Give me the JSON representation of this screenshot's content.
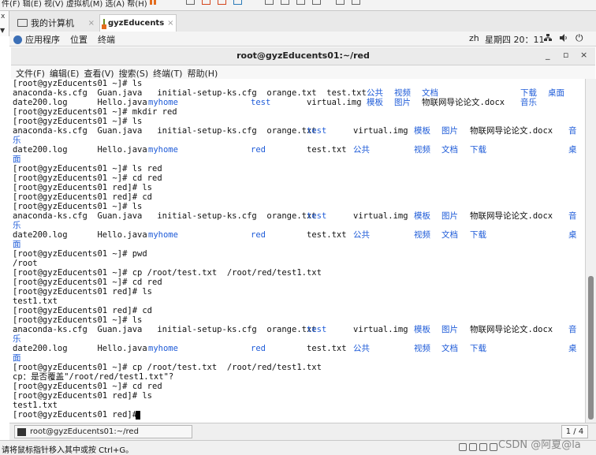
{
  "vm_toolbar": {
    "menu_text": "件(F)  辑(E)  视(V)  虚拟机(M)  选(A)  帮(H)"
  },
  "vm_left": {
    "close": "x",
    "dropdown": "▼"
  },
  "tabs": [
    {
      "label": "我的计算机",
      "close": "×",
      "icon": "computer-icon"
    },
    {
      "label": "gyzEducents",
      "close": "×",
      "icon": "vm-icon"
    }
  ],
  "topbar": {
    "applications": "应用程序",
    "places": "位置",
    "terminal": "终端",
    "lang": "zh",
    "clock": "星期四 20：11",
    "power": "⏻"
  },
  "window": {
    "title": "root@gyzEducents01:~/red",
    "minimize": "_",
    "maximize": "▫",
    "close": "×"
  },
  "menubar": [
    "文件(F)",
    "编辑(E)",
    "查看(V)",
    "搜索(S)",
    "终端(T)",
    "帮助(H)"
  ],
  "terminal": {
    "lines": [
      "[root@gyzEducents01 ~]# ls",
      "anaconda-ks.cfg  Guan.java   initial-setup-ks.cfg  orange.txt  test.txt",
      "date200.log      Hello.java",
      "[root@gyzEducents01 ~]# mkdir red",
      "[root@gyzEducents01 ~]# ls",
      "anaconda-ks.cfg  Guan.java   initial-setup-ks.cfg  orange.txt",
      "乐",
      "date200.log      Hello.java",
      "面",
      "[root@gyzEducents01 ~]# ls red",
      "[root@gyzEducents01 ~]# cd red",
      "[root@gyzEducents01 red]# ls",
      "[root@gyzEducents01 red]# cd",
      "[root@gyzEducents01 ~]# ls",
      "anaconda-ks.cfg  Guan.java   initial-setup-ks.cfg  orange.txt",
      "乐",
      "date200.log      Hello.java",
      "面",
      "[root@gyzEducents01 ~]# pwd",
      "/root",
      "[root@gyzEducents01 ~]# cp /root/test.txt  /root/red/test1.txt",
      "[root@gyzEducents01 ~]# cd red",
      "[root@gyzEducents01 red]# ls",
      "test1.txt",
      "[root@gyzEducents01 red]# cd",
      "[root@gyzEducents01 ~]# ls",
      "anaconda-ks.cfg  Guan.java   initial-setup-ks.cfg  orange.txt",
      "乐",
      "date200.log      Hello.java",
      "面",
      "[root@gyzEducents01 ~]# cp /root/test.txt  /root/red/test1.txt",
      "cp：是否覆盖\"/root/red/test1.txt\"?",
      "[root@gyzEducents01 ~]# cd red",
      "[root@gyzEducents01 red]# ls",
      "test1.txt",
      "[root@gyzEducents01 red]# "
    ],
    "blue_text": {
      "l0_gonggong": "公共",
      "l0_shipin": "视频",
      "l0_wendang": "文档",
      "l0_xiazai": "下载",
      "l0_zhuomian": "桌面",
      "l1_myhome": "myhome",
      "l1_test": "test",
      "l1_virtual": "virtual.img",
      "l1_muban": "模板",
      "l1_tupian": "图片",
      "l1_wulian": "物联网导论论文.docx",
      "l1_yinyue": "音乐",
      "r1_test": "test",
      "r1_virtual": "virtual.img",
      "r1_muban": "模板",
      "r1_tupian": "图片",
      "r1_wulian": "物联网导论论文.docx",
      "r1_yin": "音",
      "r2_myhome": "myhome",
      "r2_red": "red",
      "r2_testtxt": "test.txt",
      "r2_gonggong": "公共",
      "r2_shipin": "视频",
      "r2_wendang": "文档",
      "r2_xiazai": "下载",
      "r2_zhuo": "桌"
    }
  },
  "taskbar": {
    "task_label": "root@gyzEducents01:~/red",
    "pager": "1 / 4"
  },
  "statusbar": {
    "hint": "请将鼠标指针移入其中或按 Ctrl+G。",
    "watermark": "CSDN @阿夏@la"
  }
}
